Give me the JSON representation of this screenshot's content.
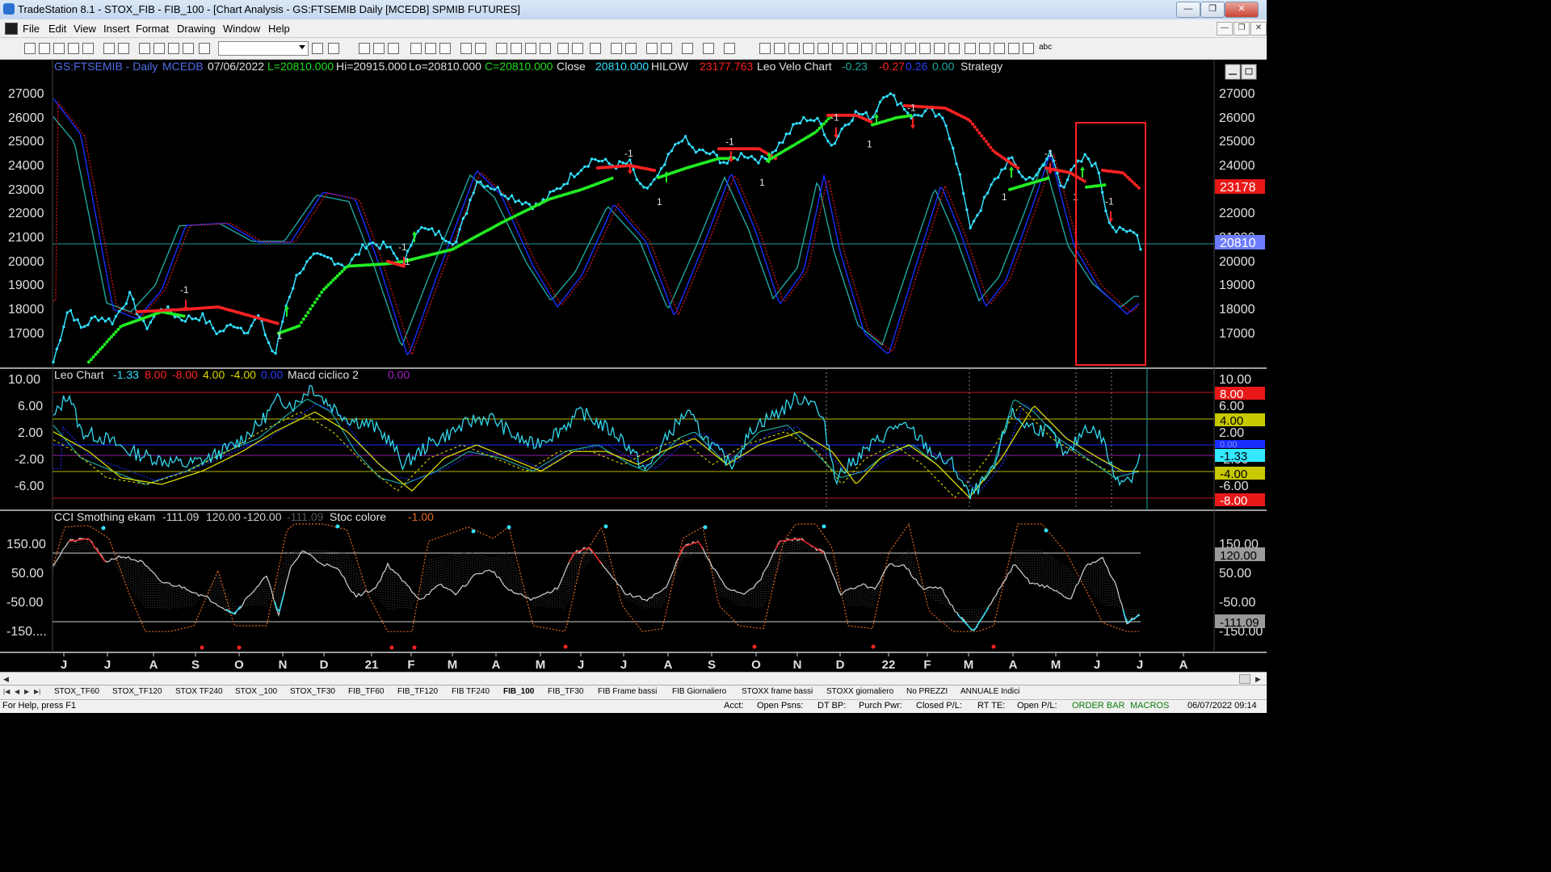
{
  "window": {
    "title": "TradeStation 8.1 - STOX_FIB - FIB_100 - [Chart Analysis - GS:FTSEMIB  Daily  [MCEDB] SPMIB FUTURES]",
    "min_label": "—",
    "max_label": "❐",
    "close_label": "✕"
  },
  "menu": {
    "items": [
      "File",
      "Edit",
      "View",
      "Insert",
      "Format",
      "Drawing",
      "Window",
      "Help"
    ],
    "mdi_min": "—",
    "mdi_restore": "❐",
    "mdi_close": "✕"
  },
  "toolbar": {
    "text_tool": "abc"
  },
  "header": {
    "symbol": "GS:FTSEMIB - Daily",
    "datafeed": "MCEDB",
    "date": "07/06/2022",
    "last": "L=20810.000",
    "hi": "Hi=20915.000",
    "lo": "Lo=20810.000",
    "close_c": "C=20810.000",
    "close_label": "Close",
    "close_value": "20810.000",
    "hilow_label": "HILOW",
    "hilow_value": "23177.763",
    "velo_label": "Leo Velo Chart",
    "velo_v1": "-0.23",
    "velo_v2": "-0.27",
    "velo_v3": "0.26",
    "velo_v4": "0.00",
    "strategy_label": "Strategy"
  },
  "panel2": {
    "label": "Leo Chart",
    "v1": "-1.33",
    "v2": "8.00",
    "v3": "-8.00",
    "v4": "4.00",
    "v5": "-4.00",
    "v6": "0.00",
    "label2": "Macd ciclico 2",
    "v7": "0.00"
  },
  "panel3": {
    "label": "CCI Smothing ekam",
    "v1": "-111.09",
    "v2": "120.00",
    "v3": "-120.00",
    "v4": "-111.09",
    "label2": "Stoc colore",
    "v5": "-1.00"
  },
  "axis_main": {
    "ticks": [
      "27000",
      "26000",
      "25000",
      "24000",
      "23000",
      "22000",
      "21000",
      "20000",
      "19000",
      "18000",
      "17000"
    ],
    "ticks_right": [
      "27000",
      "26000",
      "25000",
      "24000",
      "23000",
      "22000",
      "21000",
      "20000",
      "19000",
      "18000",
      "17000"
    ],
    "badge_hilow": "23178",
    "badge_close": "20810"
  },
  "axis_p2": {
    "ticks": [
      "10.00",
      "6.00",
      "2.00",
      "-2.00",
      "-6.00"
    ],
    "right_ticks": [
      "10.00",
      "6.00",
      "2.00",
      "-2.00",
      "-6.00"
    ],
    "badges": [
      "8.00",
      "4.00",
      "0.00",
      "-1.33",
      "-4.00",
      "-8.00"
    ]
  },
  "axis_p3": {
    "ticks": [
      "150.00",
      "50.00",
      "-50.00",
      "-150...."
    ],
    "right_ticks": [
      "150.00",
      "50.00",
      "-50.00",
      "-150.00"
    ],
    "badges": [
      "120.00",
      "-111.09"
    ]
  },
  "time_axis": [
    "J",
    "J",
    "A",
    "S",
    "O",
    "N",
    "D",
    "21",
    "F",
    "M",
    "A",
    "M",
    "J",
    "J",
    "A",
    "S",
    "O",
    "N",
    "D",
    "22",
    "F",
    "M",
    "A",
    "M",
    "J",
    "J",
    "A"
  ],
  "signals": [
    "-1",
    "1",
    "-1",
    "1",
    "-1",
    "1",
    "-1",
    "1",
    "-1",
    "1",
    "-1",
    "1",
    "-1",
    "1",
    "-1"
  ],
  "tabs": [
    "STOX_TF60",
    "STOX_TF120",
    "STOX TF240",
    "STOX _100",
    "STOX_TF30",
    "FIB_TF60",
    "FIB_TF120",
    "FIB TF240",
    "FIB_100",
    "FIB_TF30",
    "FIB Frame bassi",
    "FIB Giornaliero",
    "STOXX frame bassi",
    "STOXX giornaliero",
    "No PREZZI",
    "ANNUALE Indici"
  ],
  "active_tab": "FIB_100",
  "status": {
    "help": "For Help, press F1",
    "acct": "Acct:",
    "open_psns": "Open Psns:",
    "dt_bp": "DT BP:",
    "purch_pwr": "Purch Pwr:",
    "closed_pl": "Closed P/L:",
    "rt_te": "RT TE:",
    "open_pl": "Open P/L:",
    "order_bar": "ORDER BAR",
    "macros": "MACROS",
    "datetime": "06/07/2022 09:14"
  },
  "colors": {
    "price": "#33e0ff",
    "hilow_up": "#22ee22",
    "hilow_down": "#ff2222",
    "osc_blue": "#1a2dff",
    "osc_red": "#d01010",
    "osc_teal": "#1ea7a0",
    "yellow": "#d8d800",
    "cci": "#d0d0d0",
    "stoc": "#e06820",
    "highlight_box": "#ff2020"
  }
}
